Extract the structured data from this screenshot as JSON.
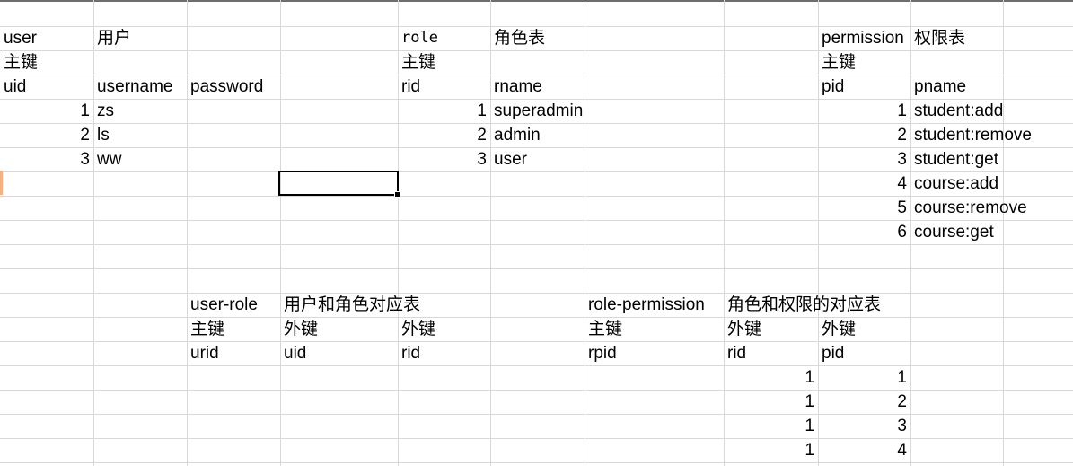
{
  "sheet": {
    "cells": [
      {
        "id": "user-title",
        "text": "user",
        "col": 0,
        "row": 1
      },
      {
        "id": "user-title-cn",
        "text": "用户",
        "col": 1,
        "row": 1
      },
      {
        "id": "role-title",
        "text": "role",
        "col": 4,
        "row": 1,
        "mono": true
      },
      {
        "id": "role-title-cn",
        "text": "角色表",
        "col": 5,
        "row": 1
      },
      {
        "id": "permission-title",
        "text": "permission",
        "col": 8,
        "row": 1
      },
      {
        "id": "permission-title-cn",
        "text": "权限表",
        "col": 9,
        "row": 1
      },
      {
        "id": "user-pk-label",
        "text": "主键",
        "col": 0,
        "row": 2
      },
      {
        "id": "role-pk-label",
        "text": "主键",
        "col": 4,
        "row": 2
      },
      {
        "id": "permission-pk-label",
        "text": "主键",
        "col": 8,
        "row": 2
      },
      {
        "id": "hdr-uid",
        "text": "uid",
        "col": 0,
        "row": 3
      },
      {
        "id": "hdr-username",
        "text": "username",
        "col": 1,
        "row": 3
      },
      {
        "id": "hdr-password",
        "text": "password",
        "col": 2,
        "row": 3
      },
      {
        "id": "hdr-rid",
        "text": "rid",
        "col": 4,
        "row": 3
      },
      {
        "id": "hdr-rname",
        "text": "rname",
        "col": 5,
        "row": 3
      },
      {
        "id": "hdr-pid",
        "text": "pid",
        "col": 8,
        "row": 3
      },
      {
        "id": "hdr-pname",
        "text": "pname",
        "col": 9,
        "row": 3
      },
      {
        "id": "user-uid-1",
        "text": "1",
        "col": 0,
        "row": 4,
        "num": true
      },
      {
        "id": "user-name-1",
        "text": "zs",
        "col": 1,
        "row": 4
      },
      {
        "id": "role-rid-1",
        "text": "1",
        "col": 4,
        "row": 4,
        "num": true
      },
      {
        "id": "role-name-1",
        "text": "superadmin",
        "col": 5,
        "row": 4
      },
      {
        "id": "perm-pid-1",
        "text": "1",
        "col": 8,
        "row": 4,
        "num": true
      },
      {
        "id": "perm-name-1",
        "text": "student:add",
        "col": 9,
        "row": 4
      },
      {
        "id": "user-uid-2",
        "text": "2",
        "col": 0,
        "row": 5,
        "num": true
      },
      {
        "id": "user-name-2",
        "text": "ls",
        "col": 1,
        "row": 5
      },
      {
        "id": "role-rid-2",
        "text": "2",
        "col": 4,
        "row": 5,
        "num": true
      },
      {
        "id": "role-name-2",
        "text": "admin",
        "col": 5,
        "row": 5
      },
      {
        "id": "perm-pid-2",
        "text": "2",
        "col": 8,
        "row": 5,
        "num": true
      },
      {
        "id": "perm-name-2",
        "text": "student:remove",
        "col": 9,
        "row": 5
      },
      {
        "id": "user-uid-3",
        "text": "3",
        "col": 0,
        "row": 6,
        "num": true
      },
      {
        "id": "user-name-3",
        "text": "ww",
        "col": 1,
        "row": 6
      },
      {
        "id": "role-rid-3",
        "text": "3",
        "col": 4,
        "row": 6,
        "num": true
      },
      {
        "id": "role-name-3",
        "text": "user",
        "col": 5,
        "row": 6
      },
      {
        "id": "perm-pid-3",
        "text": "3",
        "col": 8,
        "row": 6,
        "num": true
      },
      {
        "id": "perm-name-3",
        "text": "student:get",
        "col": 9,
        "row": 6
      },
      {
        "id": "perm-pid-4",
        "text": "4",
        "col": 8,
        "row": 7,
        "num": true
      },
      {
        "id": "perm-name-4",
        "text": "course:add",
        "col": 9,
        "row": 7
      },
      {
        "id": "perm-pid-5",
        "text": "5",
        "col": 8,
        "row": 8,
        "num": true
      },
      {
        "id": "perm-name-5",
        "text": "course:remove",
        "col": 9,
        "row": 8
      },
      {
        "id": "perm-pid-6",
        "text": "6",
        "col": 8,
        "row": 9,
        "num": true
      },
      {
        "id": "perm-name-6",
        "text": "course:get",
        "col": 9,
        "row": 9
      },
      {
        "id": "user-role-title",
        "text": "user-role",
        "col": 2,
        "row": 12
      },
      {
        "id": "user-role-title-cn",
        "text": "用户和角色对应表",
        "col": 3,
        "row": 12
      },
      {
        "id": "role-permission-title",
        "text": "role-permission",
        "col": 6,
        "row": 12
      },
      {
        "id": "role-permission-title-cn",
        "text": "角色和权限的对应表",
        "col": 7,
        "row": 12
      },
      {
        "id": "ur-pk-label",
        "text": "主键",
        "col": 2,
        "row": 13
      },
      {
        "id": "ur-fk-label-1",
        "text": "外键",
        "col": 3,
        "row": 13
      },
      {
        "id": "ur-fk-label-2",
        "text": "外键",
        "col": 4,
        "row": 13
      },
      {
        "id": "rp-pk-label",
        "text": "主键",
        "col": 6,
        "row": 13
      },
      {
        "id": "rp-fk-label-1",
        "text": "外键",
        "col": 7,
        "row": 13
      },
      {
        "id": "rp-fk-label-2",
        "text": "外键",
        "col": 8,
        "row": 13
      },
      {
        "id": "hdr-urid",
        "text": "urid",
        "col": 2,
        "row": 14
      },
      {
        "id": "hdr-ur-uid",
        "text": "uid",
        "col": 3,
        "row": 14
      },
      {
        "id": "hdr-ur-rid",
        "text": "rid",
        "col": 4,
        "row": 14
      },
      {
        "id": "hdr-rpid",
        "text": "rpid",
        "col": 6,
        "row": 14
      },
      {
        "id": "hdr-rp-rid",
        "text": "rid",
        "col": 7,
        "row": 14
      },
      {
        "id": "hdr-rp-pid",
        "text": "pid",
        "col": 8,
        "row": 14
      },
      {
        "id": "rp-rid-1",
        "text": "1",
        "col": 7,
        "row": 15,
        "num": true
      },
      {
        "id": "rp-pid-1",
        "text": "1",
        "col": 8,
        "row": 15,
        "num": true
      },
      {
        "id": "rp-rid-2",
        "text": "1",
        "col": 7,
        "row": 16,
        "num": true
      },
      {
        "id": "rp-pid-2",
        "text": "2",
        "col": 8,
        "row": 16,
        "num": true
      },
      {
        "id": "rp-rid-3",
        "text": "1",
        "col": 7,
        "row": 17,
        "num": true
      },
      {
        "id": "rp-pid-3",
        "text": "3",
        "col": 8,
        "row": 17,
        "num": true
      },
      {
        "id": "rp-rid-4",
        "text": "1",
        "col": 7,
        "row": 18,
        "num": true
      },
      {
        "id": "rp-pid-4",
        "text": "4",
        "col": 8,
        "row": 18,
        "num": true
      }
    ]
  }
}
